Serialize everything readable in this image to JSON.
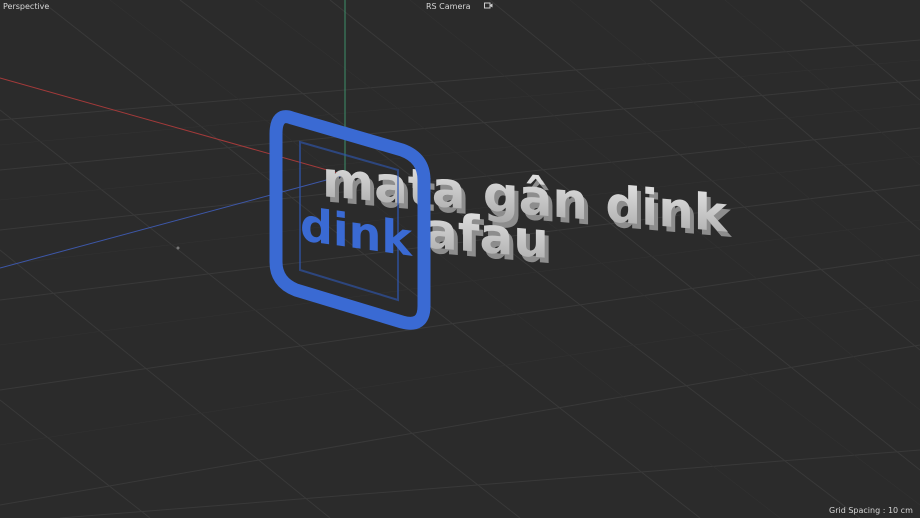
{
  "viewport": {
    "view_name": "Perspective",
    "camera_name": "RS Camera",
    "grid_spacing": "Grid Spacing : 10 cm",
    "icons": {
      "camera": "camera-icon"
    }
  },
  "scene": {
    "logo": {
      "text": "dink",
      "color": "#3a6ad3"
    },
    "text_3d": {
      "line1": "mata gân dink",
      "line2": "afau",
      "color": "#cfcfcf"
    }
  },
  "colors": {
    "background": "#2b2b2b",
    "grid": "#3a3a3a",
    "x_axis": "#a33a3a",
    "y_axis": "#3c8f6a",
    "z_axis": "#3d57a8"
  }
}
